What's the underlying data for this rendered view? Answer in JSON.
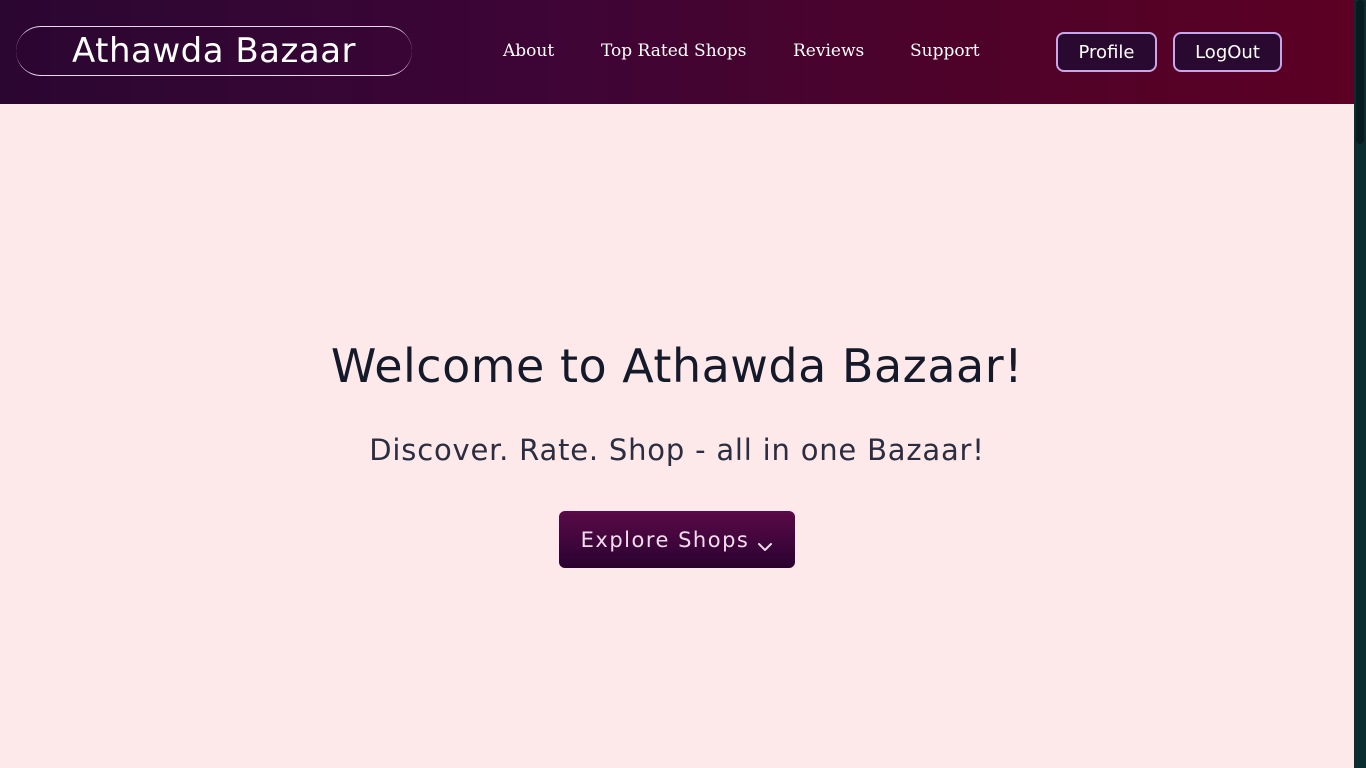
{
  "header": {
    "brand": "Athawda Bazaar",
    "nav": [
      "About",
      "Top Rated Shops",
      "Reviews",
      "Support"
    ],
    "profile_label": "Profile",
    "logout_label": "LogOut"
  },
  "hero": {
    "title": "Welcome to Athawda Bazaar!",
    "subtitle": "Discover. Rate. Shop - all in one Bazaar!",
    "cta_label": "Explore Shops"
  },
  "colors": {
    "header_gradient_start": "#2b0631",
    "header_gradient_end": "#5c0024",
    "page_background": "#fde9ea",
    "button_border": "#c8a6ea",
    "cta_background": "#3d0437"
  },
  "icons": {
    "cta_icon": "chevron-down-icon"
  }
}
